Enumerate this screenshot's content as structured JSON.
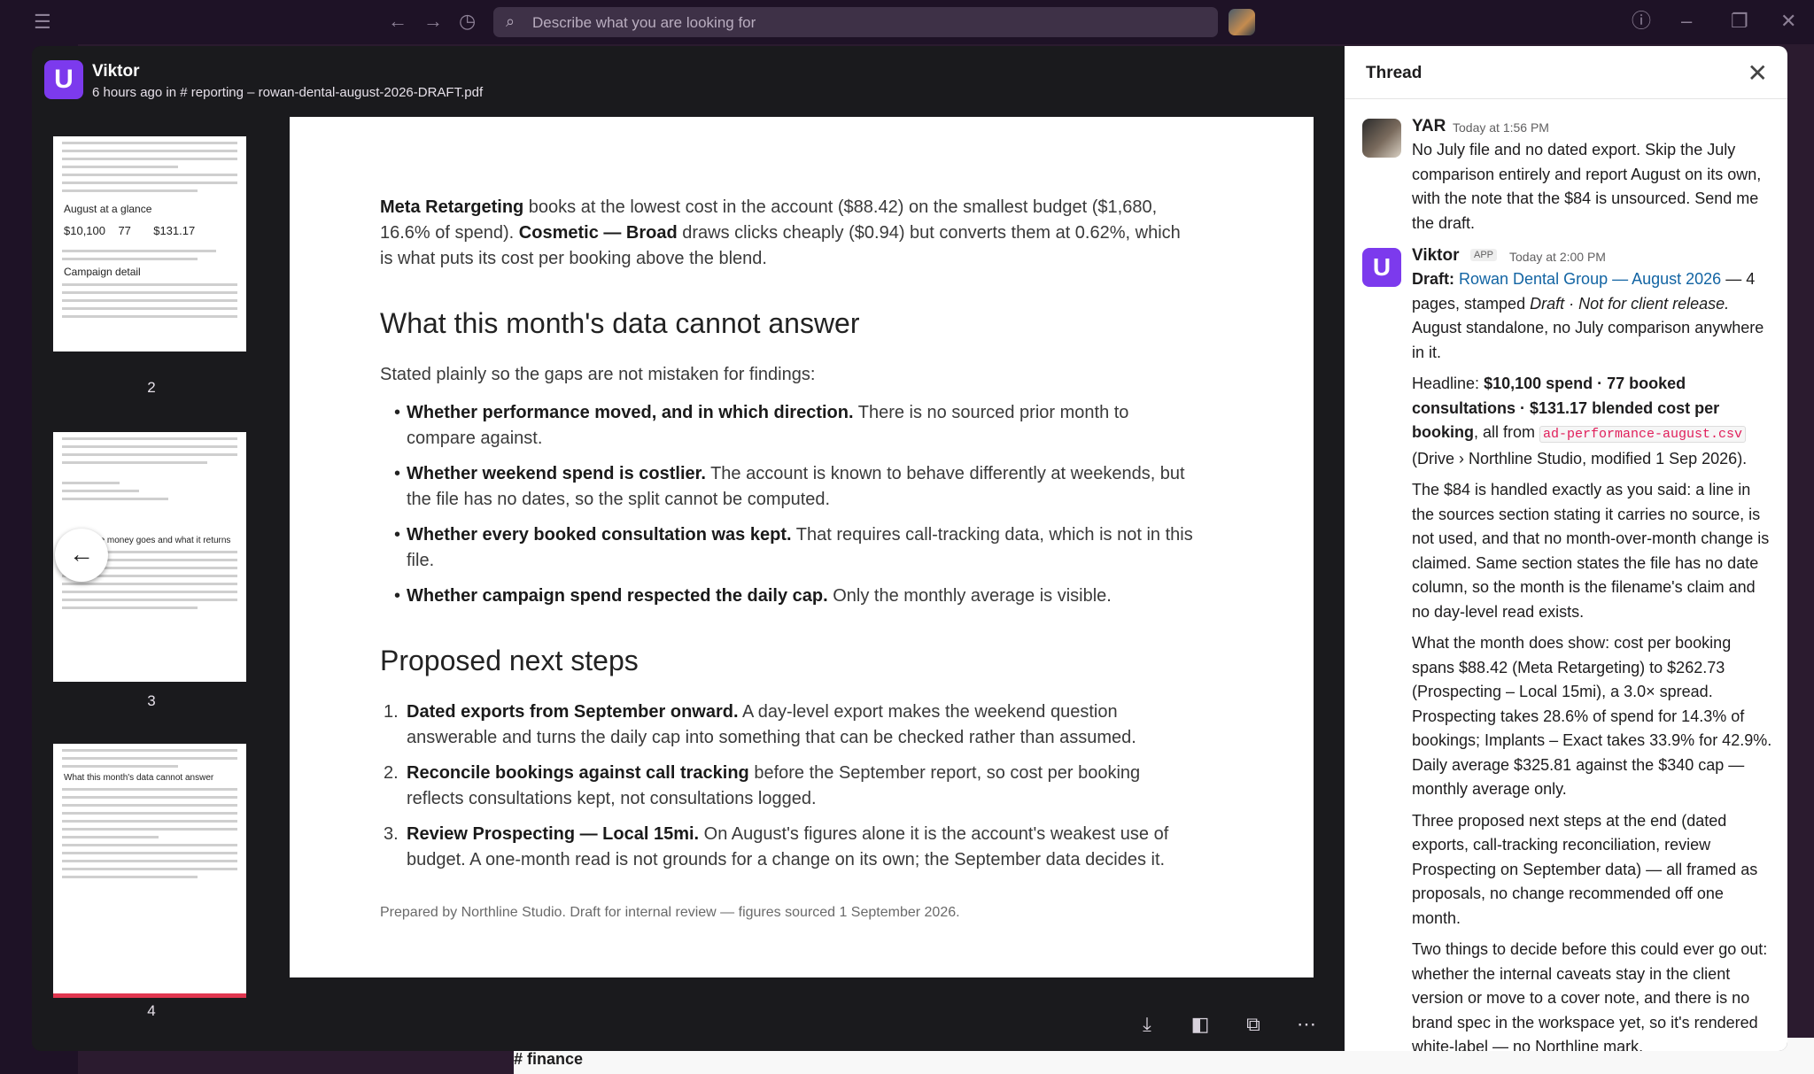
{
  "topbar": {
    "search_placeholder": "Describe what you are looking for"
  },
  "background": {
    "channel_label": "# finance"
  },
  "viewer": {
    "sender": "Viktor",
    "posted_prefix": "6 hours ago in",
    "channel": "# reporting",
    "filename": "– rowan-dental-august-2026-DRAFT.pdf",
    "thumbnails": [
      {
        "number": "2",
        "heading": "August at a glance",
        "stats": [
          "$10,100",
          "77",
          "$131.17"
        ],
        "section": "Campaign detail"
      },
      {
        "number": "3",
        "heading": "Where the money goes and what it returns"
      },
      {
        "number": "4",
        "heading": "What this month's data cannot answer"
      }
    ],
    "page": {
      "intro": {
        "b1": "Meta Retargeting",
        "t1": " books at the lowest cost in the account ($88.42) on the smallest budget ($1,680, 16.6% of spend). ",
        "b2": "Cosmetic — Broad",
        "t2": " draws clicks cheaply ($0.94) but converts them at 0.62%, which is what puts its cost per booking above the blend."
      },
      "heading1": "What this month's data cannot answer",
      "lead": "Stated plainly so the gaps are not mistaken for findings:",
      "bullets": [
        {
          "bold": "Whether performance moved, and in which direction.",
          "text": " There is no sourced prior month to compare against."
        },
        {
          "bold": "Whether weekend spend is costlier.",
          "text": " The account is known to behave differently at weekends, but the file has no dates, so the split cannot be computed."
        },
        {
          "bold": "Whether every booked consultation was kept.",
          "text": " That requires call-tracking data, which is not in this file."
        },
        {
          "bold": "Whether campaign spend respected the daily cap.",
          "text": " Only the monthly average is visible."
        }
      ],
      "heading2": "Proposed next steps",
      "steps": [
        {
          "num": "1.",
          "bold": "Dated exports from September onward.",
          "text": " A day-level export makes the weekend question answerable and turns the daily cap into something that can be checked rather than assumed."
        },
        {
          "num": "2.",
          "bold": "Reconcile bookings against call tracking",
          "text": " before the September report, so cost per booking reflects consultations kept, not consultations logged."
        },
        {
          "num": "3.",
          "bold": "Review Prospecting — Local 15mi.",
          "text": " On August's figures alone it is the account's weakest use of budget. A one-month read is not grounds for a change on its own; the September data decides it."
        }
      ],
      "footer": "Prepared by Northline Studio. Draft for internal review — figures sourced 1 September 2026."
    }
  },
  "thread": {
    "title": "Thread",
    "messages": [
      {
        "name": "YAR",
        "time": "Today at 1:56 PM",
        "text": "No July file and no dated export. Skip the July comparison entirely and report August on its own, with the note that the $84 is unsourced. Send me the draft."
      },
      {
        "name": "Viktor",
        "badge": "APP",
        "time": "Today at 2:00 PM",
        "p1_label": "Draft: ",
        "p1_link": "Rowan Dental Group — August 2026",
        "p1_text": " — 4 pages, stamped ",
        "p1_italic": "Draft · Not for client release.",
        "p1_tail": " August standalone, no July comparison anywhere in it.",
        "p2_lead": "Headline: ",
        "p2_bold": "$10,100 spend · 77 booked consultations · $131.17 blended cost per booking",
        "p2_mid": ", all from ",
        "p2_code": "ad-performance-august.csv",
        "p2_tail": " (Drive › Northline Studio, modified 1 Sep 2026).",
        "p3": "The $84 is handled exactly as you said: a line in the sources section stating it carries no source, is not used, and that no month-over-month change is claimed. Same section states the file has no date column, so the month is the filename's claim and no day-level read exists.",
        "p4": "What the month does show: cost per booking spans $88.42 (Meta Retargeting) to $262.73 (Prospecting – Local 15mi), a 3.0× spread. Prospecting takes 28.6% of spend for 14.3% of bookings; Implants – Exact takes 33.9% for 42.9%. Daily average $325.81 against the $340 cap — monthly average only.",
        "p5": "Three proposed next steps at the end (dated exports, call-tracking reconciliation, review Prospecting on September data) — all framed as proposals, no change recommended off one month.",
        "p6": "Two things to decide before this could ever go out: whether the internal caveats stay in the client version or move to a cover note, and there is no brand spec in the workspace yet, so it's rendered white-label — no Northline mark."
      }
    ]
  }
}
